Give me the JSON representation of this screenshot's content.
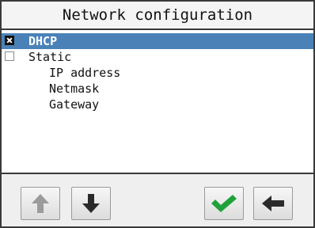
{
  "window": {
    "title": "Network configuration"
  },
  "options": [
    {
      "label": "DHCP",
      "checked": true,
      "selected": true
    },
    {
      "label": "Static",
      "checked": false,
      "selected": false
    }
  ],
  "static_fields": [
    "IP address",
    "Netmask",
    "Gateway"
  ],
  "toolbar": {
    "buttons": [
      {
        "icon": "arrow-up-icon",
        "enabled": false
      },
      {
        "icon": "arrow-down-icon",
        "enabled": true
      },
      {
        "icon": "checkmark-icon",
        "enabled": true
      },
      {
        "icon": "arrow-left-icon",
        "enabled": true
      }
    ]
  },
  "colors": {
    "selection": "#4a82b8",
    "confirm": "#1fa23a",
    "disabled_icon": "#9b9b9b",
    "icon": "#2a2a2a",
    "border": "#3a3a3a"
  }
}
